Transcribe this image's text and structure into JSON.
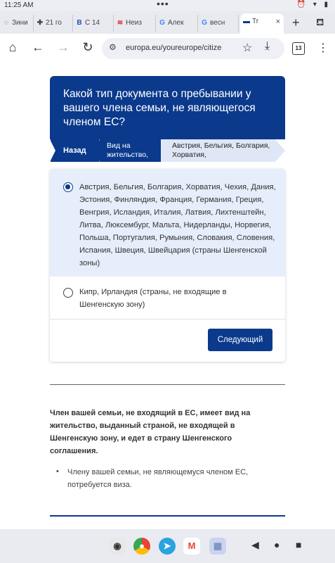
{
  "status_bar": {
    "time": "11:25 AM",
    "dots": "•••",
    "icons": "⏰ ▾ ▮"
  },
  "tabs": [
    {
      "favicon": "◌",
      "title": "Зини"
    },
    {
      "favicon": "✚",
      "title": "21 го"
    },
    {
      "favicon": "B",
      "title": "С 14"
    },
    {
      "favicon": "≋",
      "title": "Неиз"
    },
    {
      "favicon": "G",
      "title": "Алек"
    },
    {
      "favicon": "G",
      "title": "весн"
    },
    {
      "favicon": "▬",
      "title": "Tr"
    }
  ],
  "browser": {
    "url": "europa.eu/youreurope/citize",
    "tab_count": "13",
    "new_tab": "+",
    "close_tab": "×"
  },
  "question": {
    "title": "Какой тип документа о пребывании у вашего члена семьи, не являющегося членом ЕС?"
  },
  "breadcrumbs": {
    "back": "Назад",
    "step1": "Вид на жительство,",
    "current": "Австрия, Бельгия, Болгария, Хорватия,"
  },
  "options": [
    {
      "label": "Австрия, Бельгия, Болгария, Хорватия, Чехия, Дания, Эстония, Финляндия, Франция, Германия, Греция, Венгрия, Исландия, Италия, Латвия, Лихтенштейн, Литва, Люксембург, Мальта, Нидерланды, Норвегия, Польша, Португалия, Румыния, Словакия, Словения, Испания, Швеция, Швейцария (страны Шенгенской зоны)",
      "selected": true
    },
    {
      "label": "Кипр, Ирландия (страны, не входящие в Шенгенскую зону)",
      "selected": false
    }
  ],
  "next_button": "Следующий",
  "info": {
    "heading": "Член вашей семьи, не входящий в ЕС, имеет вид на жительство, выданный страной, не входящей в Шенгенскую зону, и едет в страну Шенгенского соглашения.",
    "bullets": [
      "Члену вашей семьи, не являющемуся членом ЕС, потребуется виза."
    ]
  },
  "dock": {
    "apps": [
      "camera",
      "chrome",
      "telegram",
      "gmail",
      "app-drawer"
    ],
    "nav": [
      "◀",
      "●",
      "■"
    ]
  },
  "colors": {
    "primary": "#0b3a8c",
    "option_selected_bg": "#e6eefb"
  }
}
